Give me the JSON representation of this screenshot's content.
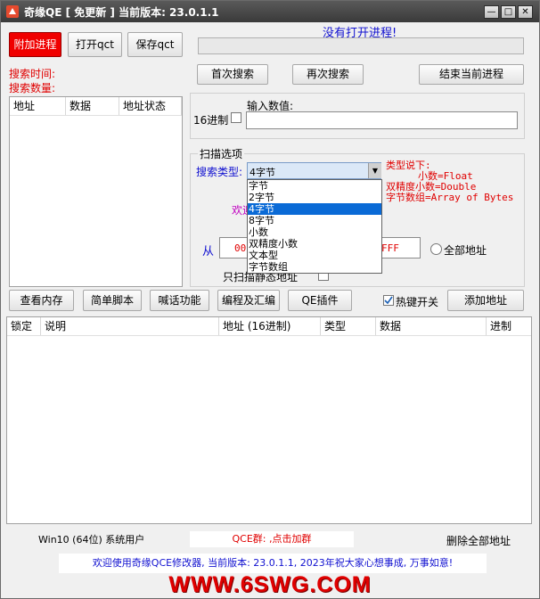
{
  "titlebar": {
    "title": "奇缘QE [ 免更新 ] 当前版本: 23.0.1.1",
    "min": "—",
    "max": "□",
    "close": "✕"
  },
  "toolbar": {
    "attach": "附加进程",
    "open_qct": "打开qct",
    "save_qct": "保存qct"
  },
  "status": {
    "no_process": "没有打开进程!",
    "search_time": "搜索时间:",
    "search_count": "搜索数量:"
  },
  "search": {
    "first": "首次搜索",
    "next": "再次搜索",
    "end_process": "结束当前进程"
  },
  "results_table": {
    "headers": [
      "地址",
      "数据",
      "地址状态"
    ]
  },
  "value_input": {
    "label": "输入数值:",
    "hex_label": "16进制",
    "value": ""
  },
  "scan_options": {
    "label": "扫描选项",
    "search_type_label": "搜索类型:",
    "selected_type": "4字节",
    "types": [
      "字节",
      "2字节",
      "4字节",
      "8字节",
      "小数",
      "双精度小数",
      "文本型",
      "字节数组"
    ],
    "type_notes": [
      "类型说下:",
      "小数=Float",
      "双精度小数=Double",
      "字节数组=Array of Bytes"
    ],
    "welcome_partial": "欢迎",
    "from_label": "从",
    "from_value": "000",
    "to_value": "FFF",
    "all_address": "全部地址",
    "static_only": "只扫描静态地址"
  },
  "actions": {
    "view_memory": "查看内存",
    "simple_script": "简单脚本",
    "shout": "喊话功能",
    "asm": "编程及汇编",
    "qe_plugin": "QE插件",
    "hotkey": "热键开关",
    "add_address": "添加地址"
  },
  "address_table": {
    "headers": [
      "锁定",
      "说明",
      "地址 (16进制)",
      "类型",
      "数据",
      "进制"
    ]
  },
  "footer": {
    "system": "Win10 (64位) 系统用户",
    "group": "QCE群: ,点击加群",
    "delete_all": "删除全部地址",
    "welcome": "欢迎使用奇缘QCE修改器, 当前版本: 23.0.1.1, 2023年祝大家心想事成, 万事如意!",
    "site": "WWW.6SWG.COM"
  },
  "colors": {
    "accent_red": "#e00000",
    "link_blue": "#1010d0",
    "selected": "#0a6ad6",
    "magenta": "#c000c0"
  }
}
